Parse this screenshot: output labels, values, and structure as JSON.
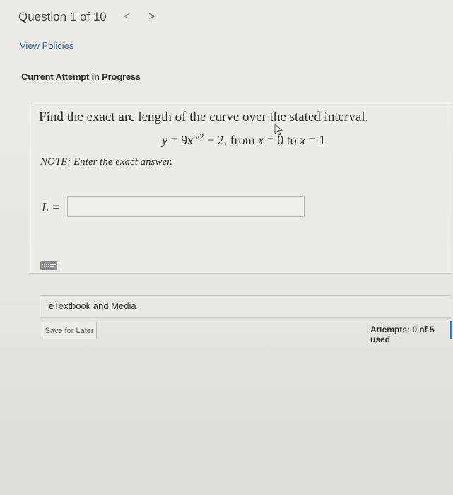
{
  "header": {
    "question_counter": "Question 1 of 10",
    "prev_icon": "chevron-left-icon",
    "next_icon": "chevron-right-icon",
    "prev_glyph": "<",
    "next_glyph": ">"
  },
  "links": {
    "view_policies": "View Policies"
  },
  "status": {
    "current_attempt": "Current Attempt in Progress"
  },
  "question": {
    "prompt": "Find the exact arc length of the curve over the stated interval.",
    "equation": {
      "lhs": "y",
      "eq": " = 9",
      "var": "x",
      "exponent": "3/2",
      "minus": " − 2, from ",
      "from_var": "x",
      "from_eq": " = 0 to ",
      "to_var": "x",
      "to_eq": " = 1"
    },
    "note": "NOTE: Enter the exact answer.",
    "answer_label": "L =",
    "answer_value": ""
  },
  "resources": {
    "etextbook_label": "eTextbook and Media"
  },
  "footer": {
    "save_label": "Save for Later",
    "attempts_text": "Attempts: 0 of 5 used"
  },
  "colors": {
    "link": "#3a6ea5",
    "accent_bar": "#2b7fd0"
  }
}
